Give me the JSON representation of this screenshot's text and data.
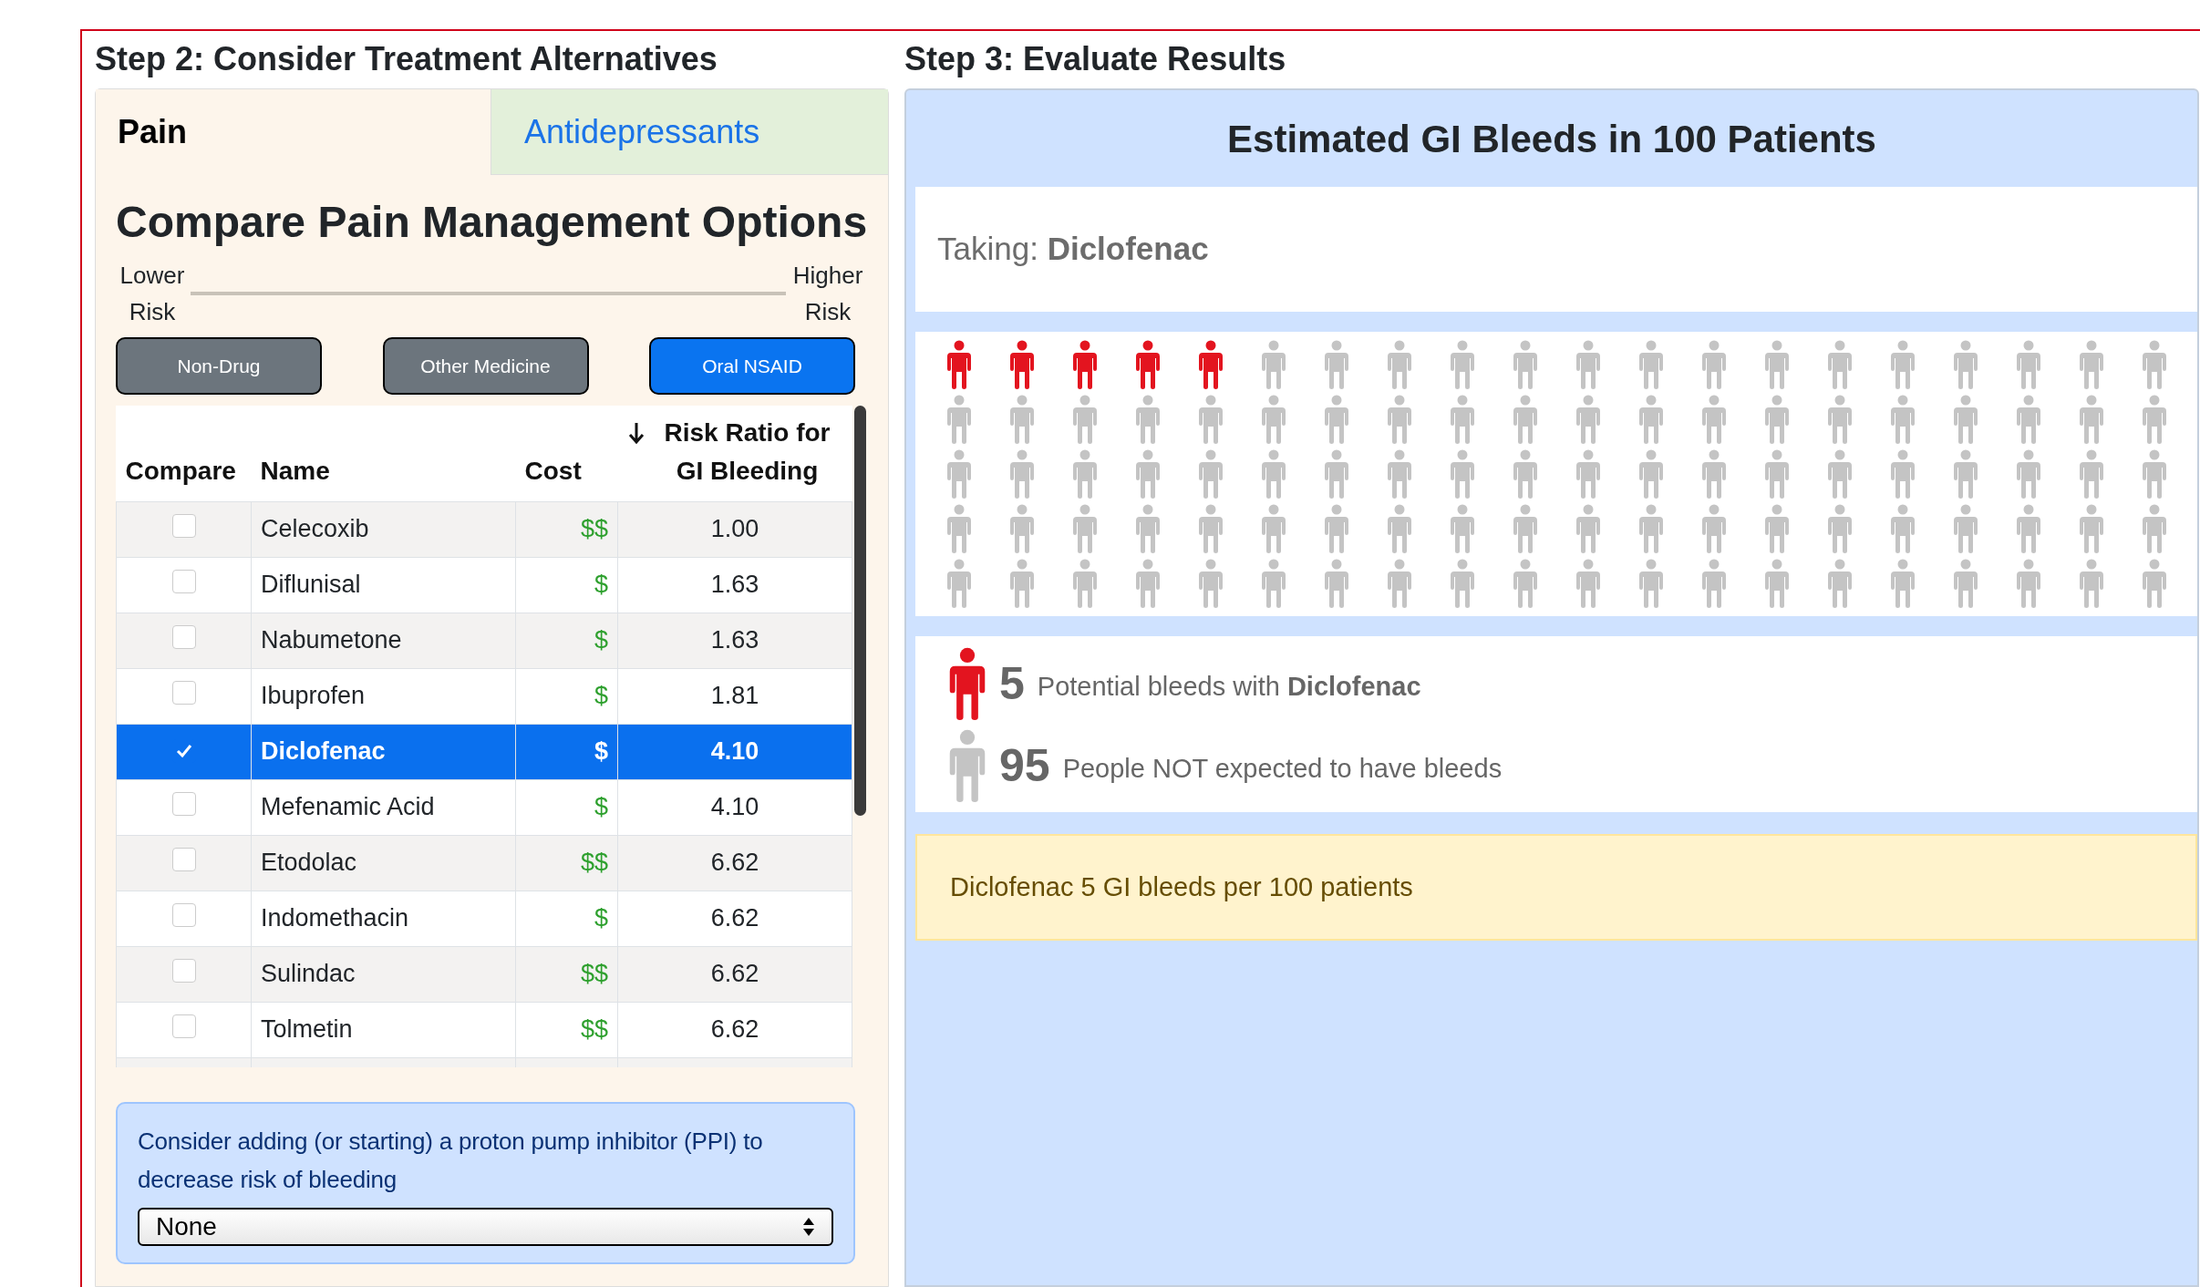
{
  "left": {
    "heading": "Step 2: Consider Treatment Alternatives",
    "tabs": [
      {
        "label": "Pain",
        "selected": true
      },
      {
        "label": "Antidepressants",
        "selected": false
      }
    ],
    "title": "Compare Pain Management Options",
    "scale": {
      "low": "Lower Risk",
      "high": "Higher Risk"
    },
    "categories": [
      {
        "label": "Non-Drug",
        "selected": false
      },
      {
        "label": "Other Medicine",
        "selected": false
      },
      {
        "label": "Oral NSAID",
        "selected": true
      }
    ],
    "table": {
      "columns": [
        "Compare",
        "Name",
        "Cost",
        "Risk Ratio for GI Bleeding"
      ],
      "rows": [
        {
          "checked": false,
          "selected": false,
          "name": "Celecoxib",
          "cost": "$$",
          "risk": "1.00"
        },
        {
          "checked": false,
          "selected": false,
          "name": "Diflunisal",
          "cost": "$",
          "risk": "1.63"
        },
        {
          "checked": false,
          "selected": false,
          "name": "Nabumetone",
          "cost": "$",
          "risk": "1.63"
        },
        {
          "checked": false,
          "selected": false,
          "name": "Ibuprofen",
          "cost": "$",
          "risk": "1.81"
        },
        {
          "checked": true,
          "selected": true,
          "name": "Diclofenac",
          "cost": "$",
          "risk": "4.10"
        },
        {
          "checked": false,
          "selected": false,
          "name": "Mefenamic Acid",
          "cost": "$",
          "risk": "4.10"
        },
        {
          "checked": false,
          "selected": false,
          "name": "Etodolac",
          "cost": "$$",
          "risk": "6.62"
        },
        {
          "checked": false,
          "selected": false,
          "name": "Indomethacin",
          "cost": "$",
          "risk": "6.62"
        },
        {
          "checked": false,
          "selected": false,
          "name": "Sulindac",
          "cost": "$$",
          "risk": "6.62"
        },
        {
          "checked": false,
          "selected": false,
          "name": "Tolmetin",
          "cost": "$$",
          "risk": "6.62"
        }
      ]
    },
    "ppi": {
      "text": "Consider adding (or starting) a proton pump inhibitor (PPI) to decrease risk of bleeding",
      "value": "None"
    }
  },
  "right": {
    "heading": "Step 3: Evaluate Results",
    "title": "Estimated GI Bleeds in 100 Patients",
    "taking": "Taking: **Diclofenac**",
    "people": [
      {
        "affected": true
      },
      {
        "affected": true
      },
      {
        "affected": true
      },
      {
        "affected": true
      },
      {
        "affected": true
      },
      {
        "affected": false
      },
      {
        "affected": false
      },
      {
        "affected": false
      },
      {
        "affected": false
      },
      {
        "affected": false
      },
      {
        "affected": false
      },
      {
        "affected": false
      },
      {
        "affected": false
      },
      {
        "affected": false
      },
      {
        "affected": false
      },
      {
        "affected": false
      },
      {
        "affected": false
      },
      {
        "affected": false
      },
      {
        "affected": false
      },
      {
        "affected": false
      },
      {
        "affected": false
      },
      {
        "affected": false
      },
      {
        "affected": false
      },
      {
        "affected": false
      },
      {
        "affected": false
      },
      {
        "affected": false
      },
      {
        "affected": false
      },
      {
        "affected": false
      },
      {
        "affected": false
      },
      {
        "affected": false
      },
      {
        "affected": false
      },
      {
        "affected": false
      },
      {
        "affected": false
      },
      {
        "affected": false
      },
      {
        "affected": false
      },
      {
        "affected": false
      },
      {
        "affected": false
      },
      {
        "affected": false
      },
      {
        "affected": false
      },
      {
        "affected": false
      },
      {
        "affected": false
      },
      {
        "affected": false
      },
      {
        "affected": false
      },
      {
        "affected": false
      },
      {
        "affected": false
      },
      {
        "affected": false
      },
      {
        "affected": false
      },
      {
        "affected": false
      },
      {
        "affected": false
      },
      {
        "affected": false
      },
      {
        "affected": false
      },
      {
        "affected": false
      },
      {
        "affected": false
      },
      {
        "affected": false
      },
      {
        "affected": false
      },
      {
        "affected": false
      },
      {
        "affected": false
      },
      {
        "affected": false
      },
      {
        "affected": false
      },
      {
        "affected": false
      },
      {
        "affected": false
      },
      {
        "affected": false
      },
      {
        "affected": false
      },
      {
        "affected": false
      },
      {
        "affected": false
      },
      {
        "affected": false
      },
      {
        "affected": false
      },
      {
        "affected": false
      },
      {
        "affected": false
      },
      {
        "affected": false
      },
      {
        "affected": false
      },
      {
        "affected": false
      },
      {
        "affected": false
      },
      {
        "affected": false
      },
      {
        "affected": false
      },
      {
        "affected": false
      },
      {
        "affected": false
      },
      {
        "affected": false
      },
      {
        "affected": false
      },
      {
        "affected": false
      },
      {
        "affected": false
      },
      {
        "affected": false
      },
      {
        "affected": false
      },
      {
        "affected": false
      },
      {
        "affected": false
      },
      {
        "affected": false
      },
      {
        "affected": false
      },
      {
        "affected": false
      },
      {
        "affected": false
      },
      {
        "affected": false
      },
      {
        "affected": false
      },
      {
        "affected": false
      },
      {
        "affected": false
      },
      {
        "affected": false
      },
      {
        "affected": false
      },
      {
        "affected": false
      },
      {
        "affected": false
      },
      {
        "affected": false
      },
      {
        "affected": false
      },
      {
        "affected": false
      }
    ],
    "legend": [
      {
        "kind": "affected",
        "count": "5",
        "text": "Potential bleeds with **Diclofenac**"
      },
      {
        "kind": "unaffected",
        "count": "95",
        "text": "People NOT expected to have bleeds"
      }
    ],
    "summary": "Diclofenac 5 GI bleeds per 100 patients"
  }
}
